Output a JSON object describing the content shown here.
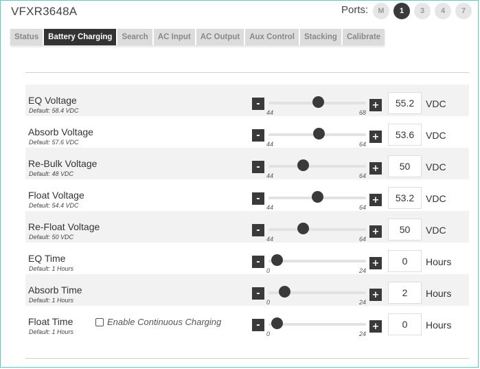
{
  "header": {
    "device_name": "VFXR3648A",
    "ports_label": "Ports:",
    "ports": [
      "M",
      "1",
      "3",
      "4",
      "7"
    ],
    "active_port": "1"
  },
  "tabs": [
    {
      "label": "Status",
      "active": false
    },
    {
      "label": "Battery Charging",
      "active": true
    },
    {
      "label": "Search",
      "active": false
    },
    {
      "label": "AC Input",
      "active": false
    },
    {
      "label": "AC Output",
      "active": false
    },
    {
      "label": "Aux Control",
      "active": false
    },
    {
      "label": "Stacking",
      "active": false
    },
    {
      "label": "Calibrate",
      "active": false
    }
  ],
  "controls": {
    "minus_label": "-",
    "plus_label": "+"
  },
  "settings": [
    {
      "label": "EQ Voltage",
      "default": "Default: 58.4 VDC",
      "min": "44",
      "max": "68",
      "value": "55.2",
      "unit": "VDC"
    },
    {
      "label": "Absorb Voltage",
      "default": "Default: 57.6 VDC",
      "min": "44",
      "max": "64",
      "value": "53.6",
      "unit": "VDC"
    },
    {
      "label": "Re-Bulk Voltage",
      "default": "Default: 48 VDC",
      "min": "44",
      "max": "64",
      "value": "50",
      "unit": "VDC"
    },
    {
      "label": "Float Voltage",
      "default": "Default: 54.4 VDC",
      "min": "44",
      "max": "64",
      "value": "53.2",
      "unit": "VDC"
    },
    {
      "label": "Re-Float Voltage",
      "default": "Default: 50 VDC",
      "min": "44",
      "max": "64",
      "value": "50",
      "unit": "VDC"
    },
    {
      "label": "EQ Time",
      "default": "Default: 1 Hours",
      "min": "0",
      "max": "24",
      "value": "0",
      "unit": "Hours"
    },
    {
      "label": "Absorb Time",
      "default": "Default: 1 Hours",
      "min": "0",
      "max": "24",
      "value": "2",
      "unit": "Hours"
    },
    {
      "label": "Float Time",
      "default": "Default: 1 Hours",
      "min": "0",
      "max": "24",
      "value": "0",
      "unit": "Hours",
      "continuous_label": "Enable Continuous Charging",
      "continuous_checked": false
    }
  ]
}
